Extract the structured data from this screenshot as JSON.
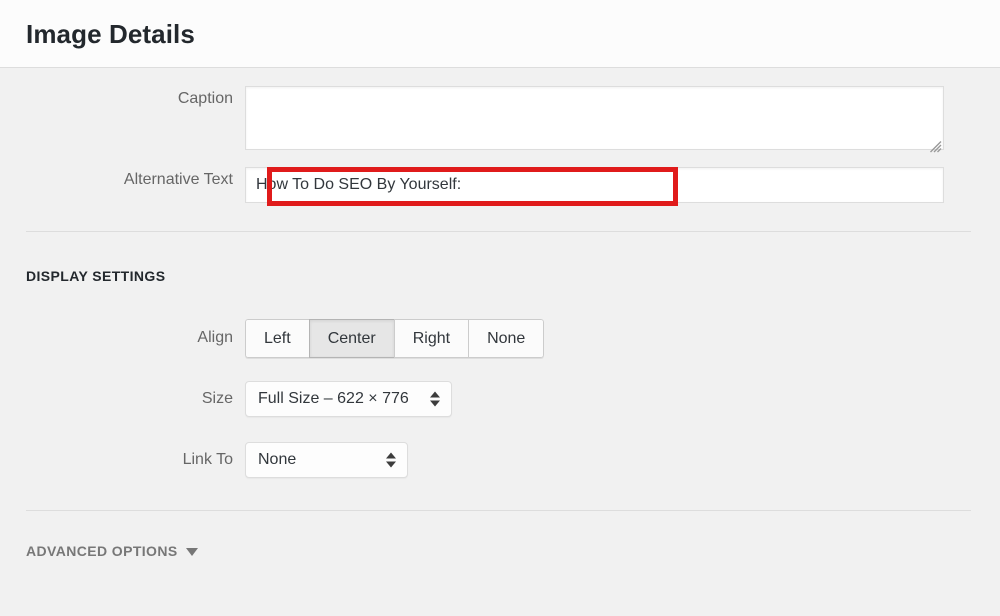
{
  "header": {
    "title": "Image Details"
  },
  "fields": {
    "caption": {
      "label": "Caption",
      "value": "",
      "placeholder": ""
    },
    "alt_text": {
      "label": "Alternative Text",
      "value": "How To Do SEO By Yourself:",
      "placeholder": ""
    }
  },
  "display_settings": {
    "heading": "DISPLAY SETTINGS",
    "align": {
      "label": "Align",
      "options": [
        "Left",
        "Center",
        "Right",
        "None"
      ],
      "selected": "Center"
    },
    "size": {
      "label": "Size",
      "selected": "Full Size – 622 × 776"
    },
    "link_to": {
      "label": "Link To",
      "selected": "None"
    }
  },
  "advanced": {
    "heading": "ADVANCED OPTIONS",
    "caret_icon": "chevron-down-icon"
  },
  "annotation": {
    "color": "#e01b1b",
    "target": "alt-text-input"
  },
  "icons": {
    "resize_grip": "resize-grip-icon",
    "select_arrows": "sort-arrows-icon"
  }
}
